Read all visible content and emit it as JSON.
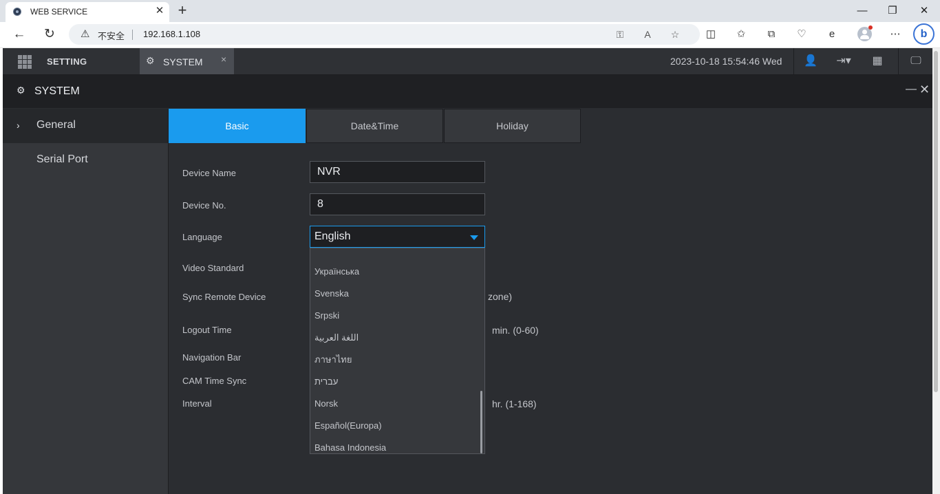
{
  "browser": {
    "tab_title": "WEB SERVICE",
    "tab_close": "✕",
    "new_tab": "+",
    "minimize": "—",
    "restore": "❐",
    "close": "✕",
    "insecure_label": "不安全",
    "url": "192.168.1.108",
    "bing_label": "b"
  },
  "app": {
    "setting_label": "SETTING",
    "system_tab_label": "SYSTEM",
    "system_tab_close": "×",
    "datetime": "2023-10-18 15:54:46 Wed",
    "panel_title": "SYSTEM",
    "panel_minimize": "—",
    "panel_close": "✕"
  },
  "sidebar": {
    "items": [
      {
        "label": "General",
        "selected": true
      },
      {
        "label": "Serial Port",
        "selected": false
      }
    ],
    "chevron": "›"
  },
  "tabs": [
    {
      "label": "Basic",
      "active": true
    },
    {
      "label": "Date&Time",
      "active": false
    },
    {
      "label": "Holiday",
      "active": false
    }
  ],
  "form": {
    "device_name_label": "Device Name",
    "device_name_value": "NVR",
    "device_no_label": "Device No.",
    "device_no_value": "8",
    "language_label": "Language",
    "language_value": "English",
    "video_standard_label": "Video Standard",
    "sync_remote_label": "Sync Remote Device",
    "sync_remote_suffix": "zone)",
    "logout_time_label": "Logout Time",
    "logout_time_suffix": "min. (0-60)",
    "navigation_bar_label": "Navigation Bar",
    "cam_time_sync_label": "CAM Time Sync",
    "interval_label": "Interval",
    "interval_suffix": "hr. (1-168)"
  },
  "language_options": [
    "",
    "Українська",
    "Svenska",
    "Srpski",
    "اللغة العربية",
    "ภาษาไทย",
    "עברית",
    "Norsk",
    "Español(Europa)",
    "Bahasa Indonesia"
  ],
  "colors": {
    "accent": "#1a9bee",
    "background": "#2b2d31",
    "header": "#1f2023"
  }
}
